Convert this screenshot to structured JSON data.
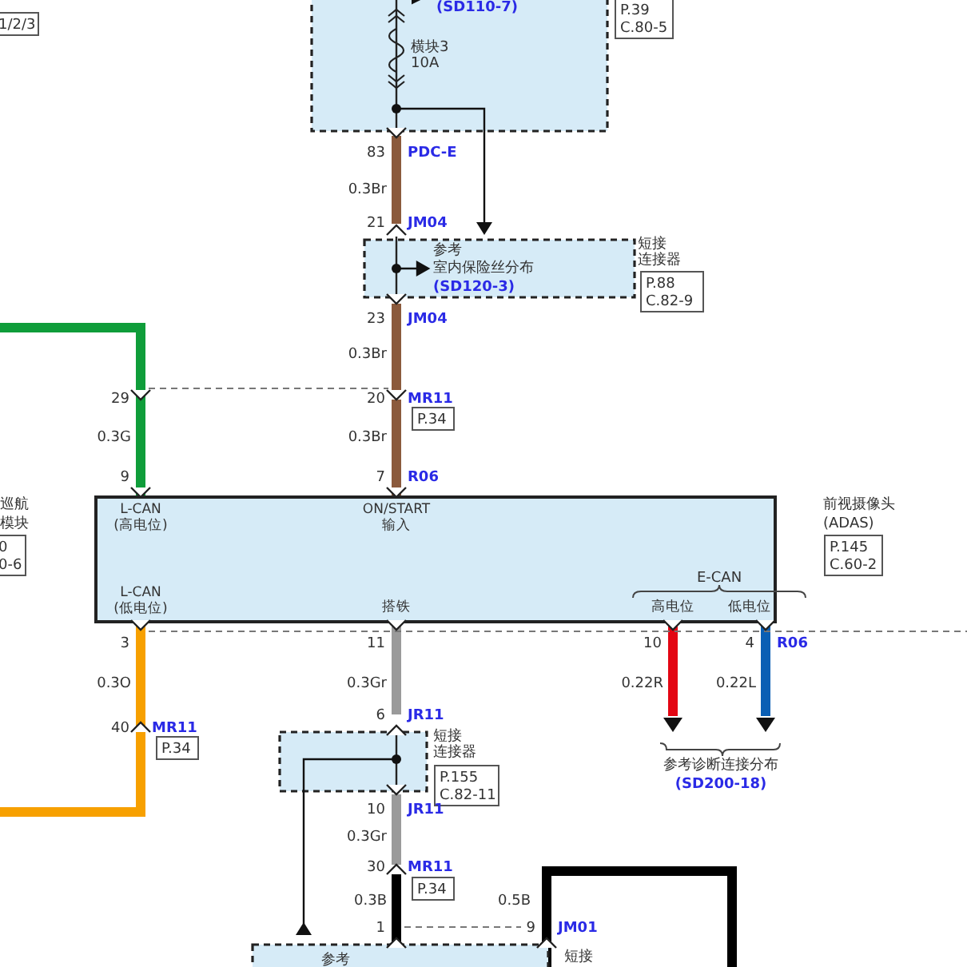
{
  "top_left_ref": [
    "1/2/3"
  ],
  "fuse_box": {
    "link": "(SD110-7)",
    "fuse_lines": [
      "横块3",
      "10A"
    ],
    "ref": [
      "P.39",
      "C.80-5"
    ]
  },
  "left_module": {
    "name_lines": [
      "巡航",
      "模块"
    ],
    "ref": [
      "0",
      "0-6"
    ]
  },
  "camera": {
    "name": "前视摄像头",
    "code": "(ADAS)",
    "ref": [
      "P.145",
      "C.60-2"
    ],
    "bus": "E-CAN",
    "pins": [
      {
        "lines": [
          "L-CAN",
          "(高电位)"
        ]
      },
      {
        "lines": [
          "ON/START",
          "输入"
        ]
      },
      {
        "lines": [
          "L-CAN",
          "(低电位)"
        ]
      },
      {
        "lines": [
          "搭铁"
        ]
      },
      {
        "lines": [
          "高电位"
        ]
      },
      {
        "lines": [
          "低电位"
        ]
      }
    ]
  },
  "wires": [
    {
      "color": "#8b5a3c",
      "gauge": "0.3Br"
    },
    {
      "color": "#8b5a3c",
      "gauge": "0.3Br"
    },
    {
      "color": "#8b5a3c",
      "gauge": "0.3Br"
    },
    {
      "color": "#0f9d3a",
      "gauge": "0.3G"
    },
    {
      "color": "#f7a000",
      "gauge": "0.3O"
    },
    {
      "color": "#9a9a9a",
      "gauge": "0.3Gr"
    },
    {
      "color": "#9a9a9a",
      "gauge": "0.3Gr"
    },
    {
      "color": "#000000",
      "gauge": "0.3B"
    },
    {
      "color": "#000000",
      "gauge": "0.5B"
    },
    {
      "color": "#e30613",
      "gauge": "0.22R"
    },
    {
      "color": "#0a5fb4",
      "gauge": "0.22L"
    }
  ],
  "terminals": [
    {
      "pin": "83",
      "connector": "PDC-E"
    },
    {
      "pin": "21",
      "connector": "JM04"
    },
    {
      "pin": "23",
      "connector": "JM04"
    },
    {
      "pin": "20",
      "connector": "MR11"
    },
    {
      "pin": "7",
      "connector": "R06"
    },
    {
      "pin": "29"
    },
    {
      "pin": "9"
    },
    {
      "pin": "3"
    },
    {
      "pin": "40",
      "connector": "MR11"
    },
    {
      "pin": "11"
    },
    {
      "pin": "6",
      "connector": "JR11"
    },
    {
      "pin": "10",
      "connector": "JR11"
    },
    {
      "pin": "30",
      "connector": "MR11"
    },
    {
      "pin": "1"
    },
    {
      "pin": "9",
      "connector": "JM01"
    },
    {
      "pin": "10"
    },
    {
      "pin": "4",
      "connector": "R06"
    }
  ],
  "page_tags": [
    "P.34",
    "P.34",
    "P.34"
  ],
  "junctions": [
    {
      "note_lines": [
        "参考",
        "室内保险丝分布"
      ],
      "link": "(SD120-3)",
      "type_lines": [
        "短接",
        "连接器"
      ],
      "ref": [
        "P.88",
        "C.82-9"
      ]
    },
    {
      "type_lines": [
        "短接",
        "连接器"
      ],
      "ref": [
        "P.155",
        "C.82-11"
      ]
    }
  ],
  "diag_ref": {
    "note": "参考诊断连接分布",
    "link": "(SD200-18)"
  },
  "bottom_box": {
    "note": "参考",
    "type_lines": [
      "短接"
    ]
  }
}
